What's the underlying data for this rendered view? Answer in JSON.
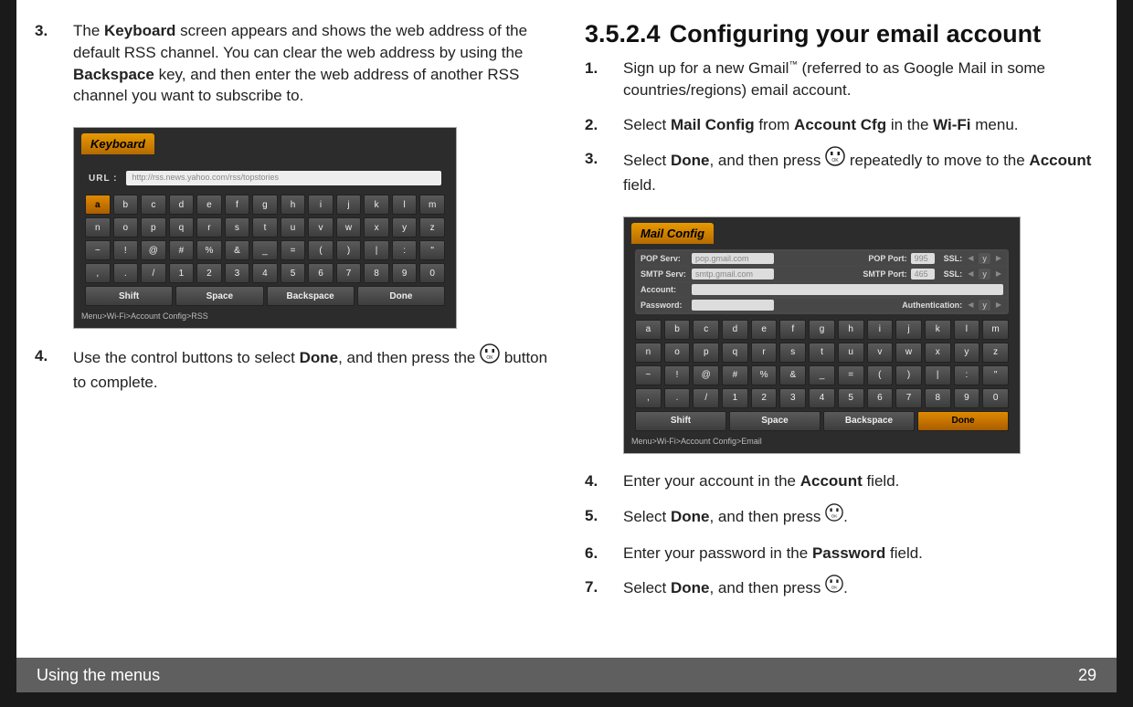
{
  "left": {
    "step3": {
      "num": "3.",
      "parts": [
        "The ",
        "Keyboard",
        " screen appears and shows the web address of the default RSS channel. You can clear the web address by using the ",
        "Backspace",
        " key, and then enter the web address of another RSS channel you want to subscribe to."
      ]
    },
    "shot": {
      "title": "Keyboard",
      "url_label": "URL :",
      "url_value": "http://rss.news.yahoo.com/rss/topstories",
      "rows": [
        [
          "a",
          "b",
          "c",
          "d",
          "e",
          "f",
          "g",
          "h",
          "i",
          "j",
          "k",
          "l",
          "m"
        ],
        [
          "n",
          "o",
          "p",
          "q",
          "r",
          "s",
          "t",
          "u",
          "v",
          "w",
          "x",
          "y",
          "z"
        ],
        [
          "~",
          "!",
          "@",
          "#",
          "%",
          "&",
          "_",
          "=",
          "(",
          ")",
          "|",
          ":",
          "\""
        ],
        [
          ",",
          ".",
          "/",
          "1",
          "2",
          "3",
          "4",
          "5",
          "6",
          "7",
          "8",
          "9",
          "0"
        ]
      ],
      "selected": "a",
      "bottom": [
        "Shift",
        "Space",
        "Backspace",
        "Done"
      ],
      "crumb": "Menu>Wi-Fi>Account Config>RSS"
    },
    "step4": {
      "num": "4.",
      "pre": "Use the control buttons to select ",
      "done": "Done",
      "mid": ", and then press the ",
      "post": " button to complete."
    }
  },
  "right": {
    "heading_num": "3.5.2.4",
    "heading_txt": "Configuring your email account",
    "s1": {
      "num": "1.",
      "parts": [
        "Sign up for a new Gmail",
        "™",
        " (referred to as Google Mail in some countries/regions) email account."
      ]
    },
    "s2": {
      "num": "2.",
      "parts": [
        "Select ",
        "Mail Config",
        " from ",
        "Account Cfg",
        " in the ",
        "Wi-Fi",
        " menu."
      ]
    },
    "s3": {
      "num": "3.",
      "pre": "Select ",
      "done": "Done",
      "mid": ", and then press ",
      "post": " repeatedly to move to the ",
      "acc": "Account",
      "end": " field."
    },
    "shot": {
      "title": "Mail Config",
      "rows": {
        "pop": {
          "lab": "POP Serv:",
          "val": "pop.gmail.com",
          "lab2": "POP Port:",
          "val2": "995",
          "lab3": "SSL:",
          "y": "y"
        },
        "smtp": {
          "lab": "SMTP Serv:",
          "val": "smtp.gmail.com",
          "lab2": "SMTP Port:",
          "val2": "465",
          "lab3": "SSL:",
          "y": "y"
        },
        "acct": {
          "lab": "Account:"
        },
        "pass": {
          "lab": "Password:",
          "lab2": "Authentication:",
          "y": "y"
        }
      },
      "kbd": [
        [
          "a",
          "b",
          "c",
          "d",
          "e",
          "f",
          "g",
          "h",
          "i",
          "j",
          "k",
          "l",
          "m"
        ],
        [
          "n",
          "o",
          "p",
          "q",
          "r",
          "s",
          "t",
          "u",
          "v",
          "w",
          "x",
          "y",
          "z"
        ],
        [
          "~",
          "!",
          "@",
          "#",
          "%",
          "&",
          "_",
          "=",
          "(",
          ")",
          "|",
          ":",
          "\""
        ],
        [
          ",",
          ".",
          "/",
          "1",
          "2",
          "3",
          "4",
          "5",
          "6",
          "7",
          "8",
          "9",
          "0"
        ]
      ],
      "bottom": [
        "Shift",
        "Space",
        "Backspace",
        "Done"
      ],
      "selected": "Done",
      "crumb": "Menu>Wi-Fi>Account Config>Email"
    },
    "s4": {
      "num": "4.",
      "parts": [
        "Enter your account in the ",
        "Account",
        " field."
      ]
    },
    "s5": {
      "num": "5.",
      "pre": "Select ",
      "done": "Done",
      "mid": ", and then press ",
      "end": "."
    },
    "s6": {
      "num": "6.",
      "parts": [
        "Enter your password in the ",
        "Password",
        " field."
      ]
    },
    "s7": {
      "num": "7.",
      "pre": "Select ",
      "done": "Done",
      "mid": ", and then press ",
      "end": "."
    }
  },
  "footer": {
    "title": "Using the menus",
    "page": "29"
  }
}
